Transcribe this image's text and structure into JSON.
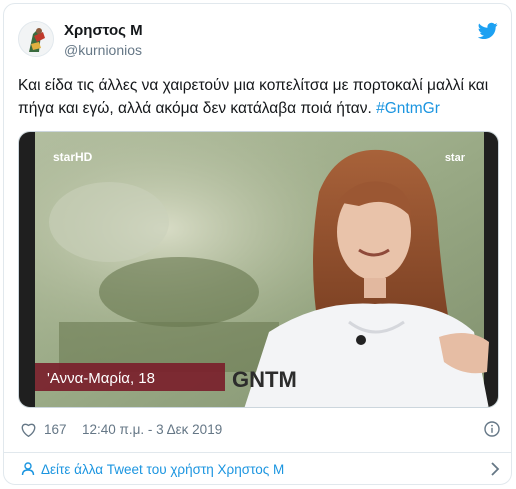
{
  "tweet": {
    "author_name": "Χρηστος Μ",
    "author_handle": "@kurnionios",
    "text": "Και είδα τις άλλες να χαιρετούν μια κοπελίτσα με πορτοκαλί μαλλί και πήγα και εγώ, αλλά ακόμα δεν κατάλαβα ποιά ήταν.",
    "hashtag": "#GntmGr",
    "likes": "167",
    "timestamp": "12:40 π.μ. - 3 Δεκ 2019",
    "more_link": "Δείτε άλλα Tweet του χρήστη Χρηστος Μ"
  },
  "media": {
    "channel_logo_left": "starHD",
    "channel_logo_right": "star",
    "caption_name": "'Αννα-Μαρία, 18",
    "show_logo": "GNTM"
  },
  "icons": {
    "platform": "bird-icon",
    "like": "heart-icon",
    "info": "info-icon",
    "profile": "person-icon",
    "go": "chevron-right-icon"
  },
  "colors": {
    "link": "#1b95e0",
    "muted": "#657786",
    "caption_bar": "#7a1f2b"
  }
}
